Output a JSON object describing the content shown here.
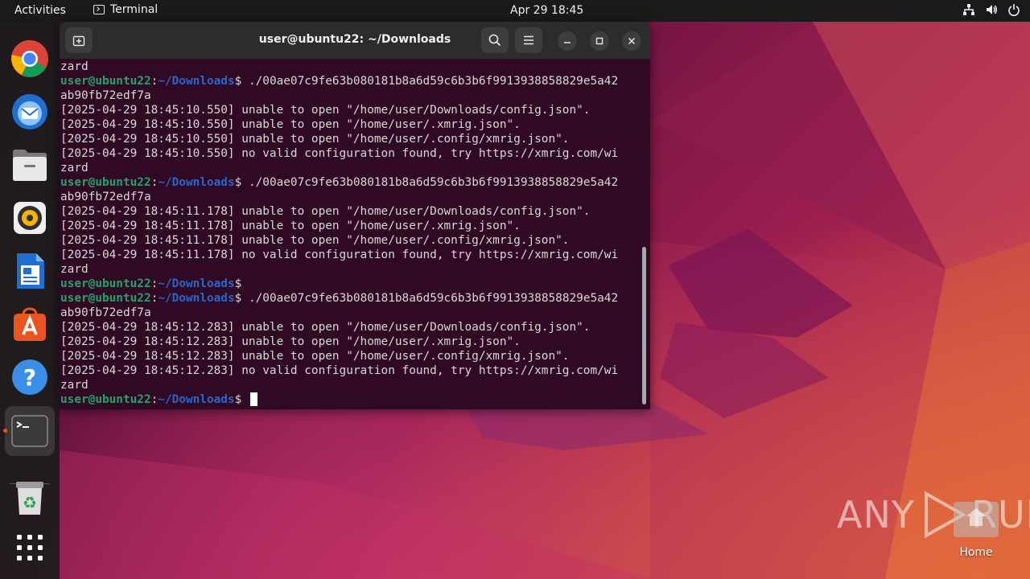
{
  "topbar": {
    "activities": "Activities",
    "app_name": "Terminal",
    "clock": "Apr 29  18:45"
  },
  "dock": {
    "items": [
      "Google Chrome",
      "Thunderbird Mail",
      "Files",
      "Rhythmbox",
      "LibreOffice Writer",
      "Ubuntu Software",
      "Help",
      "Terminal",
      "Trash",
      "Show Applications"
    ],
    "active": "Terminal",
    "accent_color": "#e95420"
  },
  "window": {
    "title": "user@ubuntu22: ~/Downloads"
  },
  "terminal": {
    "prompt_user": "user@ubuntu22",
    "prompt_sep": ":",
    "prompt_path": "~/Downloads",
    "prompt_dollar": "$ ",
    "lines": [
      {
        "text": "zard"
      },
      {
        "prompt": true,
        "text": "./00ae07c9fe63b080181b8a6d59c6b3b6f9913938858829e5a42"
      },
      {
        "text": "ab90fb72edf7a"
      },
      {
        "text": "[2025-04-29 18:45:10.550] unable to open \"/home/user/Downloads/config.json\"."
      },
      {
        "text": "[2025-04-29 18:45:10.550] unable to open \"/home/user/.xmrig.json\"."
      },
      {
        "text": "[2025-04-29 18:45:10.550] unable to open \"/home/user/.config/xmrig.json\"."
      },
      {
        "text": "[2025-04-29 18:45:10.550] no valid configuration found, try https://xmrig.com/wi"
      },
      {
        "text": "zard"
      },
      {
        "prompt": true,
        "text": "./00ae07c9fe63b080181b8a6d59c6b3b6f9913938858829e5a42"
      },
      {
        "text": "ab90fb72edf7a"
      },
      {
        "text": "[2025-04-29 18:45:11.178] unable to open \"/home/user/Downloads/config.json\"."
      },
      {
        "text": "[2025-04-29 18:45:11.178] unable to open \"/home/user/.xmrig.json\"."
      },
      {
        "text": "[2025-04-29 18:45:11.178] unable to open \"/home/user/.config/xmrig.json\"."
      },
      {
        "text": "[2025-04-29 18:45:11.178] no valid configuration found, try https://xmrig.com/wi"
      },
      {
        "text": "zard"
      },
      {
        "prompt": true,
        "text": ""
      },
      {
        "prompt": true,
        "text": "./00ae07c9fe63b080181b8a6d59c6b3b6f9913938858829e5a42"
      },
      {
        "text": "ab90fb72edf7a"
      },
      {
        "text": "[2025-04-29 18:45:12.283] unable to open \"/home/user/Downloads/config.json\"."
      },
      {
        "text": "[2025-04-29 18:45:12.283] unable to open \"/home/user/.xmrig.json\"."
      },
      {
        "text": "[2025-04-29 18:45:12.283] unable to open \"/home/user/.config/xmrig.json\"."
      },
      {
        "text": "[2025-04-29 18:45:12.283] no valid configuration found, try https://xmrig.com/wi"
      },
      {
        "text": "zard"
      },
      {
        "prompt": true,
        "text": "",
        "cursor": true
      }
    ],
    "colors": {
      "background": "#300a24",
      "user": "#26a269",
      "path": "#2a66c8"
    }
  },
  "desktop": {
    "home_label": "Home",
    "watermark": "ANY RUN"
  }
}
